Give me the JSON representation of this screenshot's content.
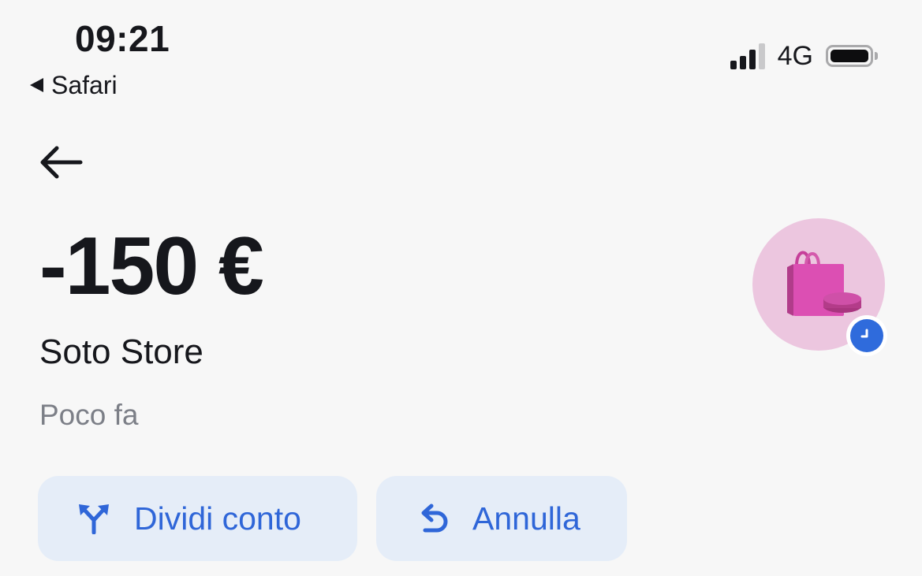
{
  "status_bar": {
    "time": "09:21",
    "back_app": "Safari",
    "network": "4G",
    "signal_bars_active": 3,
    "signal_bars_total": 4,
    "battery_level": 1.0
  },
  "nav": {
    "back_icon": "arrow-left-icon"
  },
  "transaction": {
    "amount": "-150 €",
    "merchant": "Soto Store",
    "time_ago": "Poco fa",
    "category_icon": "shopping-bag-icon",
    "status_icon": "clock-icon",
    "category_color": "#ecc6df",
    "status_color": "#2f6bdc"
  },
  "actions": {
    "split": {
      "label": "Dividi conto",
      "icon": "split-arrows-icon"
    },
    "undo": {
      "label": "Annulla",
      "icon": "undo-arrow-icon"
    },
    "accent_color": "#2f66d8",
    "button_bg": "#e5edf8"
  }
}
